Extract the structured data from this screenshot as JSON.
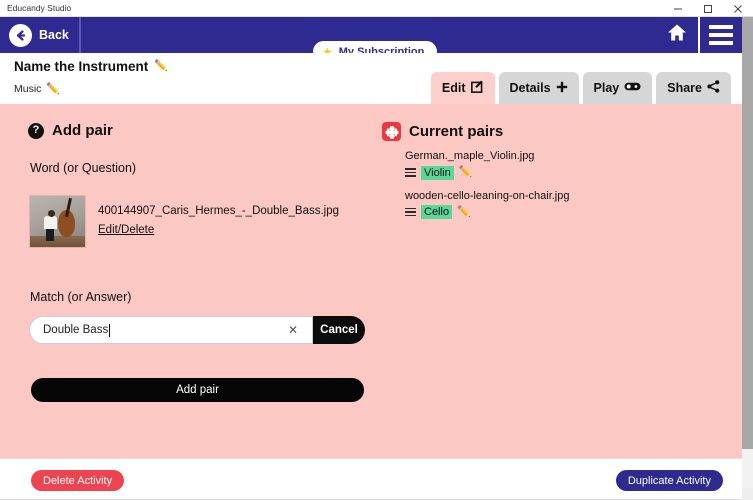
{
  "window": {
    "title": "Educandy Studio",
    "controls": {
      "minimize": "minimize-icon",
      "maximize": "maximize-icon",
      "close": "close-icon"
    }
  },
  "appbar": {
    "back_label": "Back",
    "back_icon": "arrow-left-circle-icon",
    "subscription_label": "My Subscription",
    "subscription_icon": "star-icon",
    "home_icon": "home-icon",
    "menu_icon": "hamburger-menu-icon",
    "accent_color": "#2e2a8f"
  },
  "activity": {
    "name": "Name the Instrument",
    "name_edit_icon": "pencil-icon",
    "category": "Music",
    "category_edit_icon": "pencil-icon"
  },
  "tabs": [
    {
      "label": "Edit",
      "icon": "edit-square-icon",
      "glyph": "☐",
      "active": true
    },
    {
      "label": "Details",
      "icon": "plus-icon",
      "glyph": "+",
      "active": false
    },
    {
      "label": "Play",
      "icon": "gamepad-icon",
      "glyph": "∞",
      "active": false
    },
    {
      "label": "Share",
      "icon": "share-nodes-icon",
      "glyph": "≪",
      "active": false
    }
  ],
  "add_pair": {
    "heading": "Add pair",
    "help_icon": "question-mark-help-icon",
    "word_label": "Word (or Question)",
    "word_image_name": "double-bass-photo-thumbnail",
    "word_filename": "400144907_Caris_Hermes_-_Double_Bass.jpg",
    "word_edit_delete": "Edit/Delete",
    "match_label": "Match (or Answer)",
    "match_value": "Double Bass",
    "match_placeholder": "",
    "clear_icon": "close-x-icon",
    "cancel_label": "Cancel",
    "submit_label": "Add pair"
  },
  "current_pairs": {
    "heading": "Current pairs",
    "icon": "puzzle-piece-icon",
    "items": [
      {
        "file": "German._maple_Violin.jpg",
        "answer": "Violin",
        "handle_icon": "drag-handle-icon",
        "edit_icon": "pencil-icon"
      },
      {
        "file": "wooden-cello-leaning-on-chair.jpg",
        "answer": "Cello",
        "handle_icon": "drag-handle-icon",
        "edit_icon": "pencil-icon"
      }
    ],
    "chip_color": "#5cd79a"
  },
  "footer": {
    "delete_label": "Delete Activity",
    "delete_color": "#ec4450",
    "duplicate_label": "Duplicate Activity",
    "duplicate_color": "#2e2a8f"
  },
  "theme": {
    "body_background": "#fbc8c3",
    "active_tab": "#fccfcb",
    "inactive_tab": "#d6d6d6"
  }
}
